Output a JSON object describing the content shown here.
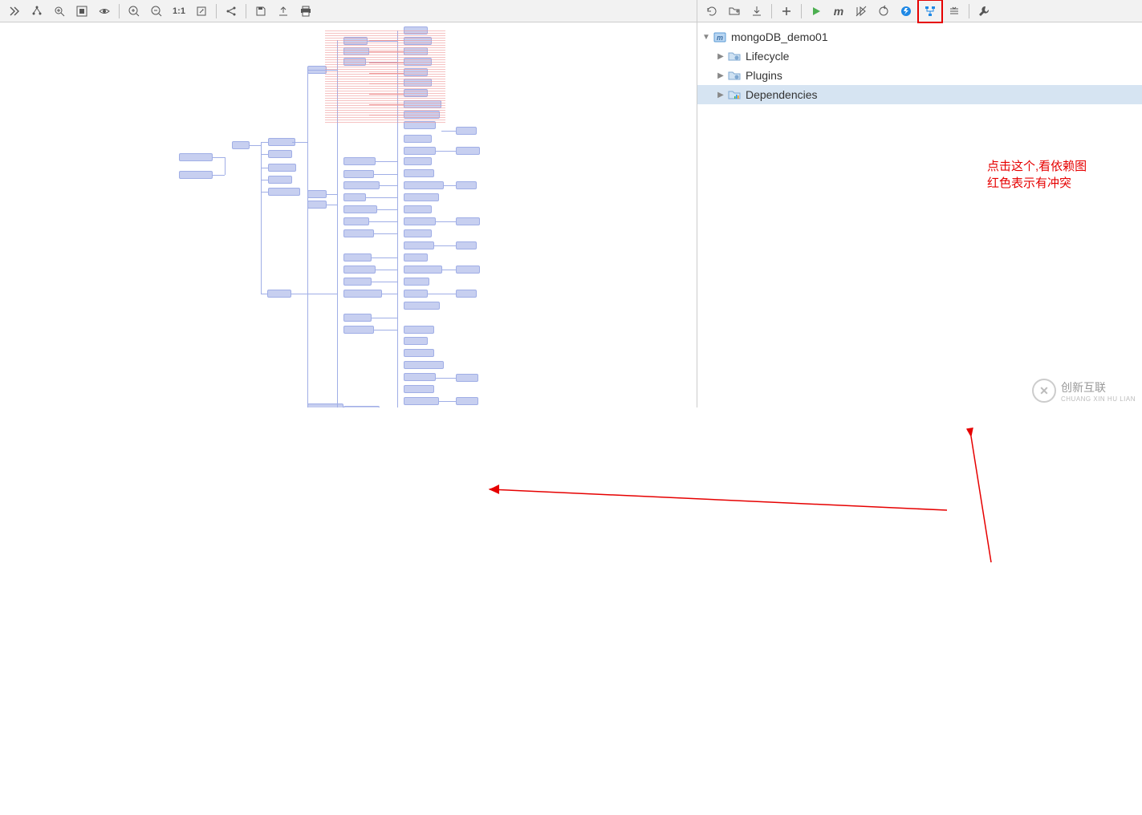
{
  "left_toolbar": {
    "icons": [
      "expand",
      "group",
      "zoom-region",
      "fit",
      "eye",
      "zoom-in",
      "zoom-out",
      "one-to-one",
      "scale",
      "share",
      "save",
      "export",
      "print"
    ]
  },
  "right_toolbar": {
    "icons": [
      "refresh",
      "folder",
      "download",
      "plus",
      "run",
      "m",
      "skip",
      "cycle",
      "flash",
      "graph",
      "collapse",
      "wrench"
    ]
  },
  "tree": {
    "root": {
      "label": "mongoDB_demo01",
      "expanded": true
    },
    "children": [
      {
        "label": "Lifecycle",
        "expanded": false
      },
      {
        "label": "Plugins",
        "expanded": false
      },
      {
        "label": "Dependencies",
        "expanded": false,
        "selected": true
      }
    ]
  },
  "annotation": {
    "line1": "点击这个,看依赖图",
    "line2": "红色表示有冲突"
  },
  "watermark": {
    "brand": "创新互联",
    "sub": "CHUANG XIN HU LIAN"
  }
}
